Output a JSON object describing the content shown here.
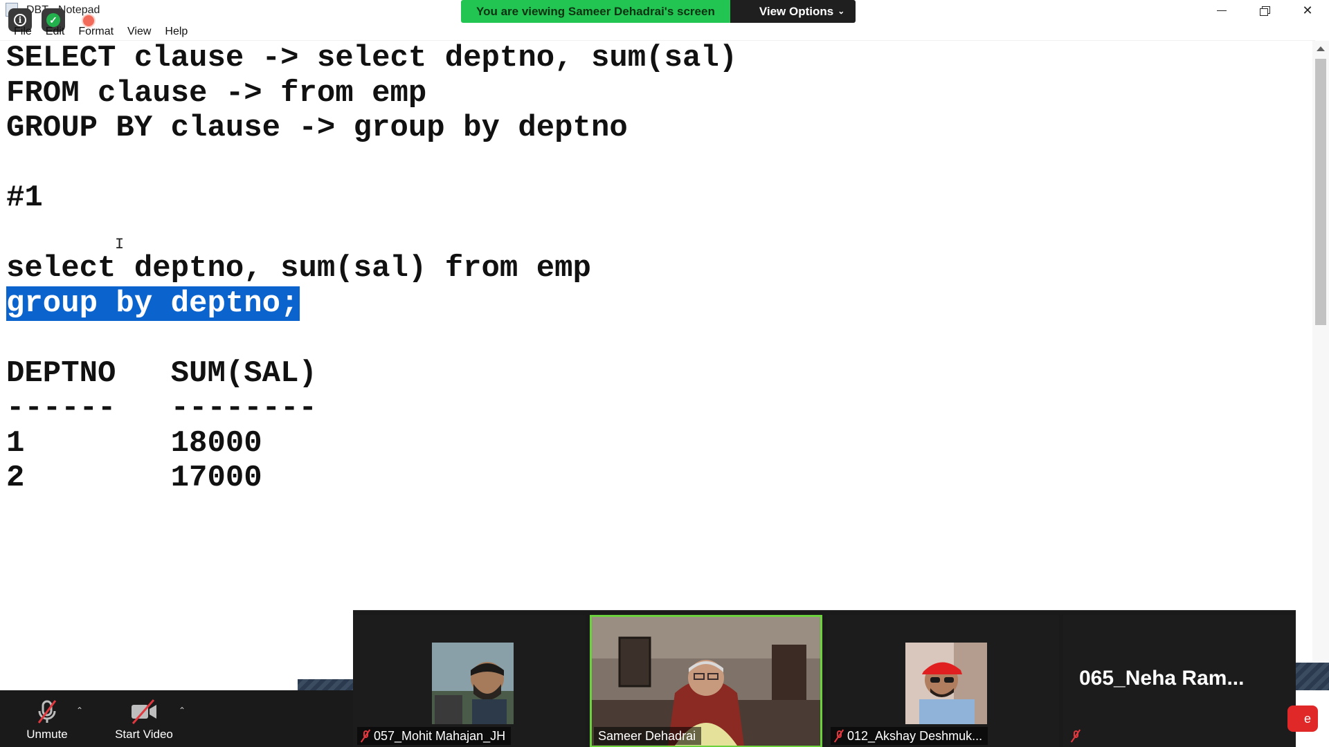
{
  "window": {
    "title": "DBT - Notepad"
  },
  "menu": {
    "items": [
      "File",
      "Edit",
      "Format",
      "View",
      "Help"
    ]
  },
  "zoom": {
    "banner_text": "You are viewing Sameer Dehadrai's screen",
    "view_options_label": "View Options",
    "unmute_label": "Unmute",
    "start_video_label": "Start Video",
    "participants": [
      {
        "name": "057_Mohit Mahajan_JH",
        "muted": true
      },
      {
        "name": "Sameer Dehadrai",
        "muted": false,
        "active_speaker": true
      },
      {
        "name": "012_Akshay Deshmuk...",
        "muted": true
      },
      {
        "name": "065_Neha  Ram...",
        "muted": true
      }
    ],
    "leave_label": "e"
  },
  "editor": {
    "lines": [
      "SELECT clause -> select deptno, sum(sal)",
      "FROM clause -> from emp",
      "GROUP BY clause -> group by deptno",
      "",
      "#1",
      "",
      "select deptno, sum(sal) from emp",
      "group by deptno;",
      "",
      "DEPTNO   SUM(SAL)",
      "------   --------",
      "1        18000",
      "2        17000"
    ],
    "selected_line_index": 7
  },
  "colors": {
    "banner_green": "#23c552",
    "selection_blue": "#0b63ce",
    "active_speaker_border": "#6bd23e",
    "muted_red": "#e0383e"
  }
}
